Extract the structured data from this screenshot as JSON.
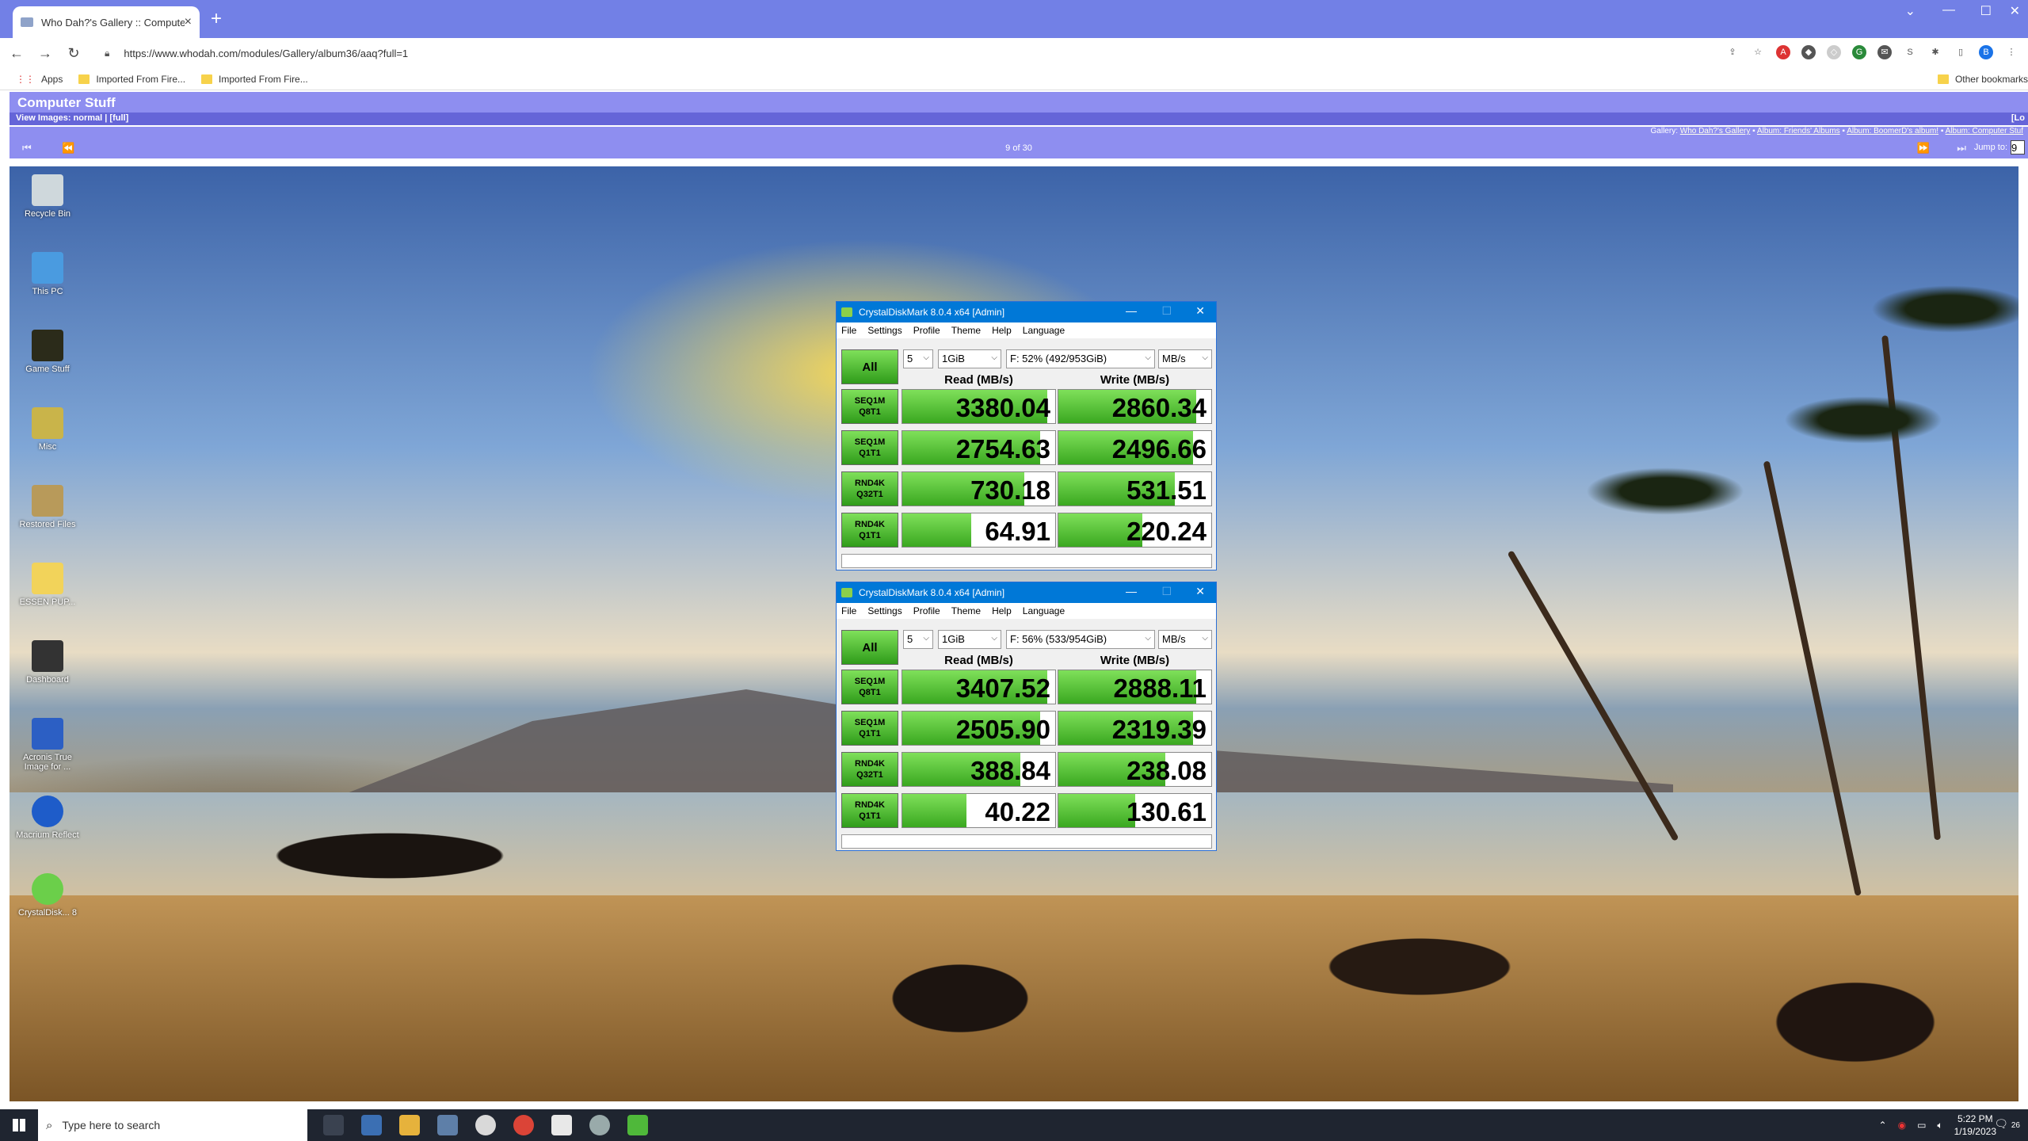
{
  "browser": {
    "tab_title": "Who Dah?'s Gallery :: Computer",
    "url": "https://www.whodah.com/modules/Gallery/album36/aaq?full=1",
    "bookmarks": [
      {
        "label": "Apps"
      },
      {
        "label": "Imported From Fire..."
      },
      {
        "label": "Imported From Fire..."
      }
    ],
    "other_bookmarks": "Other bookmarks"
  },
  "gallery": {
    "title": "Computer Stuff",
    "view_images": "View Images: normal | [full]",
    "view_right": "[Lo",
    "breadcrumb_prefix": "Gallery:",
    "breadcrumb": [
      "Who Dah?'s Gallery",
      "Album: Friends' Albums",
      "Album: BoomerD's album!",
      "Album: Computer Stuf"
    ],
    "counter": "9 of 30",
    "jump_label": "Jump to:",
    "jump_value": "9"
  },
  "desktop_icons": [
    {
      "label": "Recycle Bin",
      "icon": "recycle-bin-icon"
    },
    {
      "label": "This PC",
      "icon": "this-pc-icon"
    },
    {
      "label": "Game Stuff",
      "icon": "game-stuff-icon"
    },
    {
      "label": "Misc",
      "icon": "misc-icon"
    },
    {
      "label": "Restored Files",
      "icon": "restored-files-icon"
    },
    {
      "label": "ESSEN PUP...",
      "icon": "folder-icon"
    },
    {
      "label": "Dashboard",
      "icon": "dashboard-icon"
    },
    {
      "label": "Acronis True Image for ...",
      "icon": "acronis-icon"
    },
    {
      "label": "Macrium Reflect",
      "icon": "macrium-icon"
    },
    {
      "label": "CrystalDisk... 8",
      "icon": "crystaldisk-icon"
    }
  ],
  "cdm_windows": [
    {
      "title": "CrystalDiskMark 8.0.4 x64 [Admin]",
      "menu": [
        "File",
        "Settings",
        "Profile",
        "Theme",
        "Help",
        "Language"
      ],
      "all_label": "All",
      "count": "5",
      "size": "1GiB",
      "drive": "F: 52% (492/953GiB)",
      "unit": "MB/s",
      "read_header": "Read (MB/s)",
      "write_header": "Write (MB/s)",
      "rows": [
        {
          "l1": "SEQ1M",
          "l2": "Q8T1",
          "read": "3380.04",
          "write": "2860.34",
          "read_fill": 0.95,
          "write_fill": 0.9
        },
        {
          "l1": "SEQ1M",
          "l2": "Q1T1",
          "read": "2754.63",
          "write": "2496.66",
          "read_fill": 0.9,
          "write_fill": 0.88
        },
        {
          "l1": "RND4K",
          "l2": "Q32T1",
          "read": "730.18",
          "write": "531.51",
          "read_fill": 0.8,
          "write_fill": 0.76
        },
        {
          "l1": "RND4K",
          "l2": "Q1T1",
          "read": "64.91",
          "write": "220.24",
          "read_fill": 0.45,
          "write_fill": 0.55
        }
      ]
    },
    {
      "title": "CrystalDiskMark 8.0.4 x64 [Admin]",
      "menu": [
        "File",
        "Settings",
        "Profile",
        "Theme",
        "Help",
        "Language"
      ],
      "all_label": "All",
      "count": "5",
      "size": "1GiB",
      "drive": "F: 56% (533/954GiB)",
      "unit": "MB/s",
      "read_header": "Read (MB/s)",
      "write_header": "Write (MB/s)",
      "rows": [
        {
          "l1": "SEQ1M",
          "l2": "Q8T1",
          "read": "3407.52",
          "write": "2888.11",
          "read_fill": 0.95,
          "write_fill": 0.9
        },
        {
          "l1": "SEQ1M",
          "l2": "Q1T1",
          "read": "2505.90",
          "write": "2319.39",
          "read_fill": 0.9,
          "write_fill": 0.88
        },
        {
          "l1": "RND4K",
          "l2": "Q32T1",
          "read": "388.84",
          "write": "238.08",
          "read_fill": 0.77,
          "write_fill": 0.7
        },
        {
          "l1": "RND4K",
          "l2": "Q1T1",
          "read": "40.22",
          "write": "130.61",
          "read_fill": 0.42,
          "write_fill": 0.5
        }
      ]
    }
  ],
  "taskbar": {
    "search_placeholder": "Type here to search",
    "time": "5:22 PM",
    "date": "1/19/2023",
    "notif_count": "26"
  },
  "colors": {
    "chrome_tabbar": "#7280e6",
    "gallery_header": "#8e8ef0",
    "cdm_green": "#3aa820",
    "cdm_titlebar": "#0078d7"
  }
}
